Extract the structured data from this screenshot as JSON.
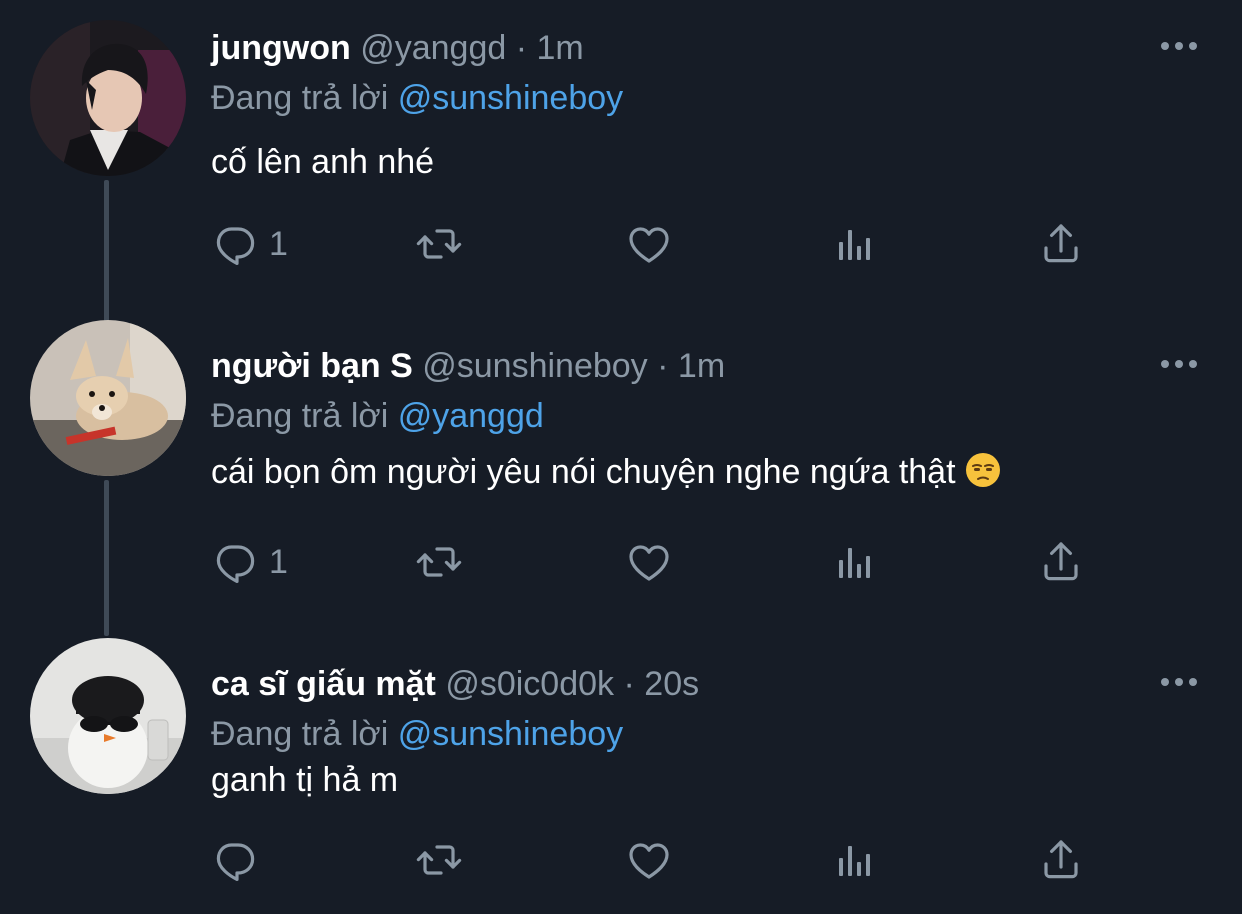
{
  "tweets": [
    {
      "display_name": "jungwon",
      "handle": "@yanggd",
      "separator": "·",
      "time": "1m",
      "reply_prefix": "Đang trả lời",
      "reply_to": "@sunshineboy",
      "text": "cố lên anh nhé",
      "reply_count": "1"
    },
    {
      "display_name": "người bạn S",
      "handle": "@sunshineboy",
      "separator": "·",
      "time": "1m",
      "reply_prefix": "Đang trả lời",
      "reply_to": "@yanggd",
      "text": "cái bọn ôm người yêu nói chuyện nghe ngứa thật",
      "emoji": "unamused-face",
      "reply_count": "1"
    },
    {
      "display_name": "ca sĩ giấu mặt",
      "handle": "@s0ic0d0k",
      "separator": "·",
      "time": "20s",
      "reply_prefix": "Đang trả lời",
      "reply_to": "@sunshineboy",
      "text": "ganh tị hả m",
      "reply_count": ""
    }
  ],
  "icons": {
    "reply": "reply-icon",
    "retweet": "retweet-icon",
    "like": "heart-icon",
    "views": "views-icon",
    "share": "share-icon",
    "more": "more-dots-icon"
  },
  "colors": {
    "background": "#161c26",
    "primary_text": "#ffffff",
    "secondary_text": "#8b98a5",
    "mention": "#4ea3e8",
    "thread_line": "#3f4a57"
  }
}
